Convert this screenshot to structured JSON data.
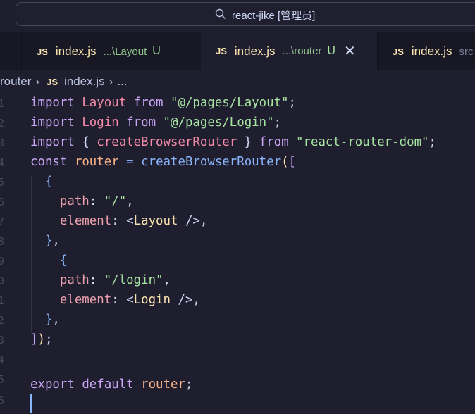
{
  "titlebar": {
    "search_text": "react-jike [管理员]"
  },
  "tabs": [
    {
      "icon": "JS",
      "name": "index.js",
      "hint": "...\\Layout",
      "badge": "U",
      "active": false
    },
    {
      "icon": "JS",
      "name": "index.js",
      "hint": "...\\router",
      "badge": "U",
      "active": true,
      "close": "✕"
    },
    {
      "icon": "JS",
      "name": "index.js",
      "hint": "src",
      "active": false
    }
  ],
  "breadcrumb": {
    "folder": "router",
    "sep": "›",
    "icon": "JS",
    "file": "index.js",
    "more": "..."
  },
  "gutter": [
    "1",
    "2",
    "3",
    "4",
    "5",
    "6",
    "7",
    "8",
    "9",
    "0",
    "1",
    "2",
    "3",
    "4",
    "5",
    "6"
  ],
  "code": {
    "l1": {
      "kw": "import",
      "id": "Layout",
      "from": "from",
      "str": "\"@/pages/Layout\"",
      "end": ";"
    },
    "l2": {
      "kw": "import",
      "id": "Login",
      "from": "from",
      "str": "\"@/pages/Login\"",
      "end": ";"
    },
    "l3": {
      "kw": "import",
      "open": "{",
      "id": "createBrowserRouter",
      "close": "}",
      "from": "from",
      "str": "\"react-router-dom\"",
      "end": ";"
    },
    "l4": {
      "kw": "const",
      "id": "router",
      "eq": "=",
      "fn": "createBrowserRouter",
      "paren": "(",
      "brack": "["
    },
    "l5": {
      "brace": "{"
    },
    "l6": {
      "prop": "path",
      "colon": ":",
      "str": "\"/\"",
      "comma": ","
    },
    "l7": {
      "prop": "element",
      "colon": ":",
      "lt": "<",
      "tag": "Layout",
      "selfclose": "/>",
      "comma": ","
    },
    "l8": {
      "brace": "}",
      "comma": ","
    },
    "l9": {
      "brace": "{"
    },
    "l10": {
      "prop": "path",
      "colon": ":",
      "str": "\"/login\"",
      "comma": ","
    },
    "l11": {
      "prop": "element",
      "colon": ":",
      "lt": "<",
      "tag": "Login",
      "selfclose": "/>",
      "comma": ","
    },
    "l12": {
      "brace": "}",
      "comma": ","
    },
    "l13": {
      "brack": "]",
      "paren": ")",
      "end": ";"
    },
    "l15": {
      "kw1": "export",
      "kw2": "default",
      "id": "router",
      "end": ";"
    }
  },
  "colors": {
    "background": "#1e1e2e",
    "keyword": "#cba6f7",
    "identifier": "#f38ba8",
    "function": "#89b4fa",
    "string": "#a6e3a1",
    "js_icon": "#f9e2af",
    "untracked_badge": "#a6e3a1"
  }
}
